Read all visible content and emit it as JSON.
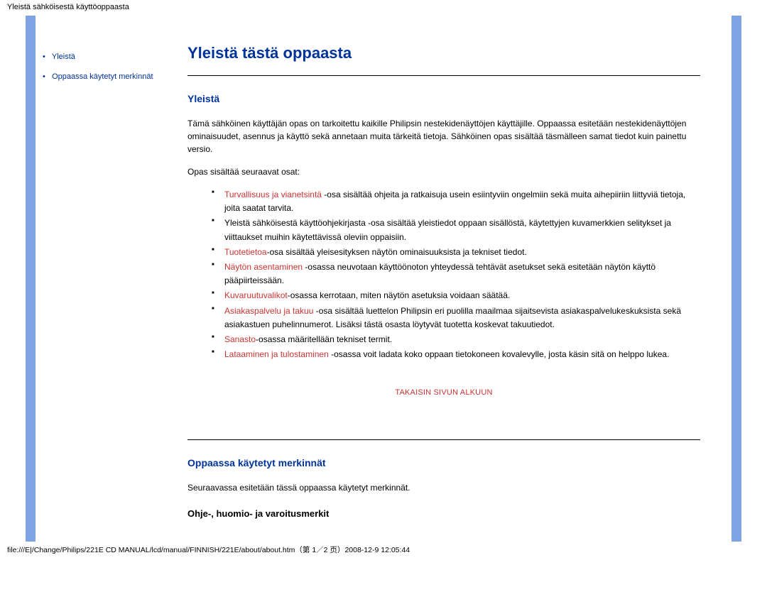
{
  "header_path": "Yleistä sähköisestä käyttöoppaasta",
  "sidebar": {
    "items": [
      {
        "bullet": "•",
        "label": "Yleistä"
      },
      {
        "bullet": "•",
        "label": "Oppaassa käytetyt merkinnät"
      }
    ]
  },
  "main": {
    "title": "Yleistä tästä oppaasta",
    "section1": {
      "heading": "Yleistä",
      "intro": "Tämä sähköinen käyttäjän opas on tarkoitettu kaikille Philipsin nestekidenäyttöjen käyttäjille. Oppaassa esitetään nestekidenäyttöjen ominaisuudet, asennus ja käyttö sekä annetaan muita tärkeitä tietoja. Sähköinen opas sisältää täsmälleen samat tiedot kuin painettu versio.",
      "parts_intro": "Opas sisältää seuraavat osat:",
      "parts": [
        {
          "link": "Turvallisuus ja vianetsintä ",
          "rest": "-osa sisältää ohjeita ja ratkaisuja usein esiintyviin ongelmiin sekä muita aihepiiriin liittyviä tietoja, joita saatat tarvita."
        },
        {
          "link": "",
          "rest": "Yleistä sähköisestä käyttöohjekirjasta -osa sisältää yleistiedot oppaan sisällöstä, käytettyjen kuvamerkkien selitykset ja viittaukset muihin käytettävissä oleviin oppaisiin."
        },
        {
          "link": "Tuotetietoa",
          "rest": "-osa sisältää yleisesityksen näytön ominaisuuksista ja tekniset tiedot."
        },
        {
          "link": "Näytön asentaminen ",
          "rest": "-osassa neuvotaan käyttöönoton yhteydessä tehtävät asetukset sekä esitetään näytön käyttö pääpiirteissään."
        },
        {
          "link": "Kuvaruutuvalikot",
          "rest": "-osassa kerrotaan, miten näytön asetuksia voidaan säätää."
        },
        {
          "link": "Asiakaspalvelu ja takuu ",
          "rest": "-osa sisältää luettelon Philipsin eri puolilla maailmaa sijaitsevista asiakaspalvelukeskuksista sekä asiakastuen puhelinnumerot. Lisäksi tästä osasta löytyvät tuotetta koskevat takuutiedot."
        },
        {
          "link": "Sanasto",
          "rest": "-osassa määritellään tekniset termit."
        },
        {
          "link": "Lataaminen ja tulostaminen ",
          "rest": "-osassa voit ladata koko oppaan tietokoneen kovalevylle, josta käsin sitä on helppo lukea."
        }
      ],
      "back_top": "TAKAISIN SIVUN ALKUUN"
    },
    "section2": {
      "heading": "Oppaassa käytetyt merkinnät",
      "intro": "Seuraavassa esitetään tässä oppaassa käytetyt merkinnät.",
      "subheading": "Ohje-, huomio- ja varoitusmerkit"
    }
  },
  "footer_path": "file:///E|/Change/Philips/221E CD MANUAL/lcd/manual/FINNISH/221E/about/about.htm（第 1／2 页）2008-12-9 12:05:44"
}
